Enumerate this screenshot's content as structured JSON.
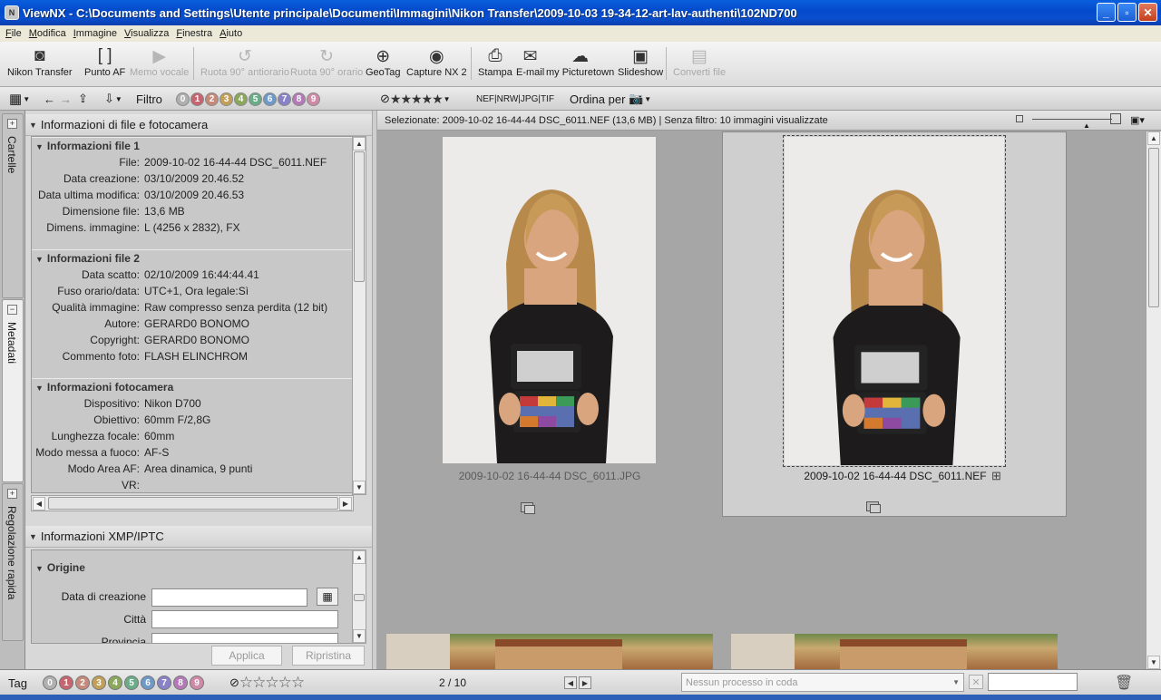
{
  "window": {
    "title": "ViewNX - C:\\Documents and Settings\\Utente principale\\Documenti\\Immagini\\Nikon Transfer\\2009-10-03 19-34-12-art-lav-authenti\\102ND700"
  },
  "menu": [
    "File",
    "Modifica",
    "Immagine",
    "Visualizza",
    "Finestra",
    "Aiuto"
  ],
  "toolbar": {
    "buttons": [
      {
        "label": "Nikon Transfer",
        "icon": "camera-transfer-icon",
        "enabled": true
      },
      {
        "label": "Punto AF",
        "icon": "af-point-icon",
        "enabled": true
      },
      {
        "label": "Memo vocale",
        "icon": "voice-memo-icon",
        "enabled": false
      },
      {
        "label": "Ruota 90° antiorario",
        "icon": "rotate-ccw-icon",
        "enabled": false
      },
      {
        "label": "Ruota 90° orario",
        "icon": "rotate-cw-icon",
        "enabled": false
      },
      {
        "label": "GeoTag",
        "icon": "geotag-icon",
        "enabled": true
      },
      {
        "label": "Capture NX 2",
        "icon": "capture-nx-icon",
        "enabled": true
      },
      {
        "label": "Stampa",
        "icon": "print-icon",
        "enabled": true
      },
      {
        "label": "E-mail",
        "icon": "email-icon",
        "enabled": true
      },
      {
        "label": "my Picturetown",
        "icon": "picturetown-icon",
        "enabled": true
      },
      {
        "label": "Slideshow",
        "icon": "slideshow-icon",
        "enabled": true
      },
      {
        "label": "Converti file",
        "icon": "convert-file-icon",
        "enabled": false
      }
    ]
  },
  "filterbar": {
    "filter_label": "Filtro",
    "labels": [
      "0",
      "1",
      "2",
      "3",
      "4",
      "5",
      "6",
      "7",
      "8",
      "9"
    ],
    "file_types": "NEF|NRW|JPG|TIF",
    "sort_label": "Ordina per"
  },
  "label_colors": [
    "#b0b0b0",
    "#c4656f",
    "#c78a7a",
    "#c2a05a",
    "#8ba85a",
    "#6aab88",
    "#6d9ac9",
    "#8a82c6",
    "#b47ab8",
    "#cf8aa8"
  ],
  "side_tabs": [
    "Cartelle",
    "Metadati",
    "Regolazione rapida"
  ],
  "panels": {
    "file_info_title": "Informazioni di file e fotocamera",
    "sections": [
      {
        "title": "Informazioni file 1",
        "rows": [
          {
            "k": "File:",
            "v": "2009-10-02 16-44-44 DSC_6011.NEF"
          },
          {
            "k": "Data creazione:",
            "v": "03/10/2009 20.46.52"
          },
          {
            "k": "Data ultima modifica:",
            "v": "03/10/2009 20.46.53"
          },
          {
            "k": "Dimensione file:",
            "v": "13,6 MB"
          },
          {
            "k": "Dimens. immagine:",
            "v": "L (4256 x 2832), FX"
          }
        ]
      },
      {
        "title": "Informazioni file 2",
        "rows": [
          {
            "k": "Data scatto:",
            "v": "02/10/2009 16:44:44.41"
          },
          {
            "k": "Fuso orario/data:",
            "v": "UTC+1, Ora legale:Sì"
          },
          {
            "k": "Qualità immagine:",
            "v": "Raw compresso senza perdita (12 bit)"
          },
          {
            "k": "Autore:",
            "v": "GERARD0 BONOMO"
          },
          {
            "k": "Copyright:",
            "v": "GERARD0 BONOMO"
          },
          {
            "k": "Commento foto:",
            "v": "FLASH ELINCHROM"
          }
        ]
      },
      {
        "title": "Informazioni fotocamera",
        "rows": [
          {
            "k": "Dispositivo:",
            "v": "Nikon D700"
          },
          {
            "k": "Obiettivo:",
            "v": "60mm F/2,8G"
          },
          {
            "k": "Lunghezza focale:",
            "v": "60mm"
          },
          {
            "k": "Modo messa a fuoco:",
            "v": "AF-S"
          },
          {
            "k": "Modo Area AF:",
            "v": "Area dinamica, 9 punti"
          },
          {
            "k": "VR:",
            "v": ""
          }
        ]
      }
    ],
    "xmp_title": "Informazioni XMP/IPTC",
    "xmp": {
      "section": "Origine",
      "fields": [
        "Data di creazione",
        "Città",
        "Provincia"
      ],
      "apply": "Applica",
      "reset": "Ripristina"
    }
  },
  "main": {
    "header": "Selezionate: 2009-10-02 16-44-44 DSC_6011.NEF (13,6 MB) | Senza filtro: 10 immagini visualizzate",
    "thumbs": [
      {
        "name": "2009-10-02 16-44-44 DSC_6011.JPG",
        "selected": false
      },
      {
        "name": "2009-10-02 16-44-44 DSC_6011.NEF",
        "selected": true
      }
    ]
  },
  "statusbar": {
    "tag_label": "Tag",
    "labels": [
      "0",
      "1",
      "2",
      "3",
      "4",
      "5",
      "6",
      "7",
      "8",
      "9"
    ],
    "page": "2 / 10",
    "process": "Nessun processo in coda"
  }
}
